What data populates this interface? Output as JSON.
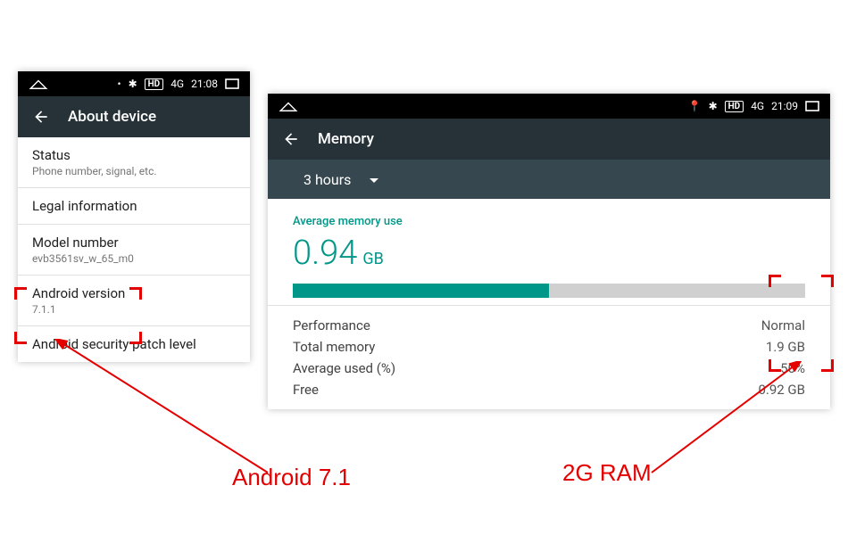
{
  "statusbar": {
    "hd": "HD",
    "net": "4G",
    "time1": "21:08",
    "time2": "21:09"
  },
  "left": {
    "toolbar_title": "About device",
    "status_primary": "Status",
    "status_secondary": "Phone number, signal, etc.",
    "legal": "Legal information",
    "model_primary": "Model number",
    "model_secondary": "evb3561sv_w_65_m0",
    "ver_primary": "Android version",
    "ver_secondary": "7.1.1",
    "patch": "Android security patch level"
  },
  "right": {
    "toolbar_title": "Memory",
    "dropdown": "3 hours",
    "avg_label": "Average memory use",
    "value_num": "0.94",
    "value_unit": "GB",
    "perf_label": "Performance",
    "perf_val": "Normal",
    "total_label": "Total memory",
    "total_val": "1.9 GB",
    "avgp_label": "Average used (%)",
    "avgp_val": "50%",
    "free_label": "Free",
    "free_val": "0.92 GB",
    "bar_fill": "50%"
  },
  "annotations": {
    "android": "Android 7.1",
    "ram": "2G RAM"
  }
}
